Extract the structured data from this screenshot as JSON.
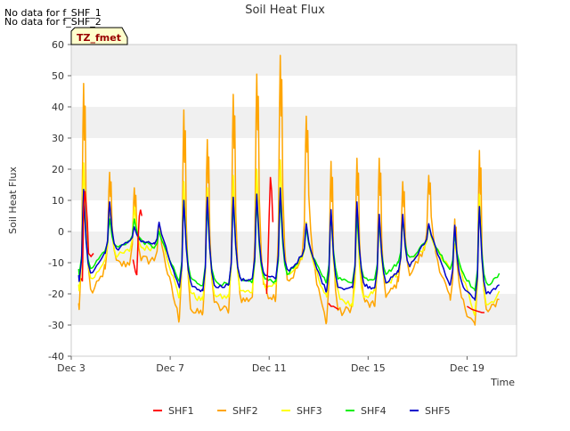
{
  "notes": [
    "No data for f_SHF_1",
    "No data for f_SHF_2"
  ],
  "badge": "TZ_fmet",
  "chart_data": {
    "type": "line",
    "title": "Soil Heat Flux",
    "xlabel": "Time",
    "ylabel": "Soil Heat Flux",
    "xlim": [
      3.0,
      21.0
    ],
    "ylim": [
      -40,
      60
    ],
    "yticks": [
      -40,
      -30,
      -20,
      -10,
      0,
      10,
      20,
      30,
      40,
      50,
      60
    ],
    "xticks": [
      {
        "value": 3,
        "label": "Dec 3"
      },
      {
        "value": 7,
        "label": "Dec 7"
      },
      {
        "value": 11,
        "label": "Dec 11"
      },
      {
        "value": 15,
        "label": "Dec 15"
      },
      {
        "value": 19,
        "label": "Dec 19"
      }
    ],
    "grid": "horizontal bands",
    "legend_position": "bottom-center",
    "series": [
      {
        "name": "SHF1",
        "color": "#ff0000",
        "visible_segments": [
          {
            "x": [
              3.4,
              3.45,
              3.5,
              3.55,
              3.6,
              3.65,
              3.7,
              3.8,
              3.9
            ],
            "y": [
              -15,
              -16,
              7,
              13,
              9,
              3,
              -7,
              -8,
              -7
            ]
          },
          {
            "x": [
              5.5,
              5.55,
              5.6,
              5.65,
              5.7,
              5.75,
              5.8,
              5.85
            ],
            "y": [
              -9,
              -11,
              -13,
              -14,
              -3,
              5,
              7,
              5
            ]
          },
          {
            "x": [
              10.9,
              10.95,
              11.0,
              11.05,
              11.1,
              11.15
            ],
            "y": [
              -20,
              -10,
              5,
              17.5,
              13,
              3
            ]
          },
          {
            "x": [
              13.4,
              13.5,
              13.6,
              13.7,
              13.8
            ],
            "y": [
              -23,
              -24,
              -24,
              -24.5,
              -25
            ]
          },
          {
            "x": [
              19.0,
              19.2,
              19.4,
              19.6,
              19.7
            ],
            "y": [
              -24,
              -25,
              -25.5,
              -26,
              -26
            ]
          }
        ]
      },
      {
        "name": "SHF2",
        "color": "#ffa500"
      },
      {
        "name": "SHF3",
        "color": "#ffff00"
      },
      {
        "name": "SHF4",
        "color": "#00ee00"
      },
      {
        "name": "SHF5",
        "color": "#0000cc"
      }
    ],
    "days": {
      "start": 3.3,
      "peaks": [
        {
          "x": 3.5,
          "SHF2": 47.5,
          "SHF3": 22,
          "SHF4": 11,
          "SHF5": 13.5,
          "base2": -25,
          "base3": -19,
          "base4": -14,
          "base5": -16
        },
        {
          "x": 4.55,
          "SHF2": 19,
          "SHF3": 8,
          "SHF4": 4,
          "SHF5": 9.5,
          "base2": -12,
          "base3": -9,
          "base4": -6,
          "base5": -7
        },
        {
          "x": 5.55,
          "SHF2": 14,
          "SHF3": 8,
          "SHF4": 4,
          "SHF5": 1.5,
          "base2": -10,
          "base3": -6,
          "base4": -3,
          "base5": -3
        },
        {
          "x": 6.55,
          "SHF2": 2,
          "SHF3": 1,
          "SHF4": 0,
          "SHF5": 3,
          "base2": -9,
          "base3": -5,
          "base4": -5,
          "base5": -4
        },
        {
          "x": 7.55,
          "SHF2": 39,
          "SHF3": 16,
          "SHF4": 10,
          "SHF5": 10,
          "base2": -28,
          "base3": -21,
          "base4": -16,
          "base5": -18
        },
        {
          "x": 8.5,
          "SHF2": 29.5,
          "SHF3": 14,
          "SHF4": 8,
          "SHF5": 11,
          "base2": -26,
          "base3": -22,
          "base4": -17,
          "base5": -19
        },
        {
          "x": 9.55,
          "SHF2": 44,
          "SHF3": 18,
          "SHF4": 10,
          "SHF5": 11,
          "base2": -25,
          "base3": -21,
          "base4": -17,
          "base5": -17
        },
        {
          "x": 10.5,
          "SHF2": 50.5,
          "SHF3": 20,
          "SHF4": 10,
          "SHF5": 12,
          "base2": -21,
          "base3": -19,
          "base4": -16,
          "base5": -15
        },
        {
          "x": 11.45,
          "SHF2": 56.5,
          "SHF3": 23,
          "SHF4": 11,
          "SHF5": 14,
          "base2": -21,
          "base3": -17,
          "base4": -16,
          "base5": -15
        },
        {
          "x": 12.5,
          "SHF2": 37,
          "SHF3": 3,
          "SHF4": 1,
          "SHF5": 2.5,
          "base2": -9,
          "base3": -9,
          "base4": -8,
          "base5": -8
        },
        {
          "x": 13.5,
          "SHF2": 22.5,
          "SHF3": 5,
          "SHF4": 6,
          "SHF5": 7,
          "base2": -29,
          "base3": -21,
          "base4": -16,
          "base5": -19
        },
        {
          "x": 14.55,
          "SHF2": 23.5,
          "SHF3": 6,
          "SHF4": 5,
          "SHF5": 9.5,
          "base2": -24,
          "base3": -24,
          "base4": -16,
          "base5": -18
        },
        {
          "x": 15.45,
          "SHF2": 23.5,
          "SHF3": 3,
          "SHF4": 3,
          "SHF5": 5.5,
          "base2": -24,
          "base3": -19,
          "base4": -15,
          "base5": -18
        },
        {
          "x": 16.4,
          "SHF2": 16,
          "SHF3": 4,
          "SHF4": 4,
          "SHF5": 5.5,
          "base2": -16,
          "base3": -13,
          "base4": -10,
          "base5": -13
        },
        {
          "x": 17.45,
          "SHF2": 18,
          "SHF3": 2,
          "SHF4": 2,
          "SHF5": 2.5,
          "base2": -6,
          "base3": -5,
          "base4": -4,
          "base5": -4
        },
        {
          "x": 18.5,
          "SHF2": 4,
          "SHF3": -4,
          "SHF4": -1,
          "SHF5": 2,
          "base2": -22,
          "base3": -12,
          "base4": -12,
          "base5": -17
        },
        {
          "x": 19.5,
          "SHF2": 26,
          "SHF3": 12,
          "SHF4": 8,
          "SHF5": 8,
          "base2": -30,
          "base3": -26,
          "base4": -19,
          "base5": -22
        }
      ],
      "end": {
        "x": 20.3,
        "SHF2": -21,
        "SHF3": -20,
        "SHF4": -14,
        "SHF5": -17
      }
    }
  }
}
